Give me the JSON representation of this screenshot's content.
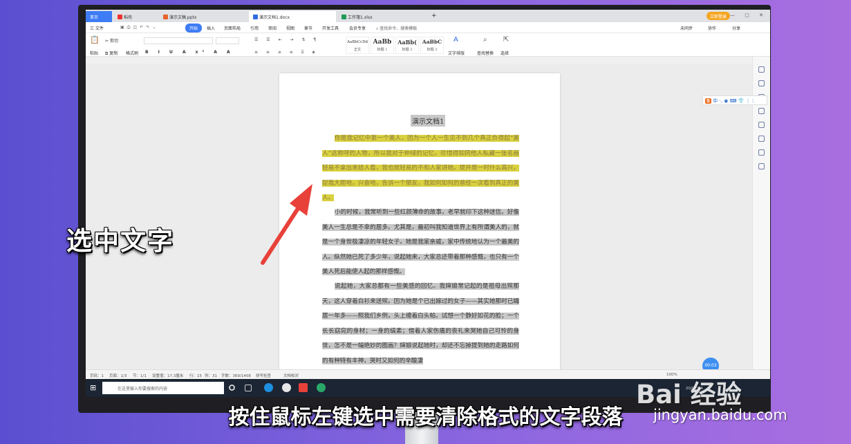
{
  "tabs": [
    {
      "label": "首页"
    },
    {
      "label": "稻壳"
    },
    {
      "label": "演示文稿.pptx"
    },
    {
      "label": "演示文档1.docx"
    },
    {
      "label": "工作簿1.xlsx"
    }
  ],
  "tab_add": "+",
  "login_label": "立即登录",
  "menu": {
    "file": "三 文件",
    "start": "开始",
    "items": [
      "插入",
      "页面布局",
      "引用",
      "审阅",
      "视图",
      "章节",
      "开发工具",
      "会员专享"
    ],
    "search": "查找命令、搜索模板",
    "right": [
      "未同步",
      "协作",
      "分享"
    ]
  },
  "ribbon": {
    "paste": "粘贴",
    "cut": "剪切",
    "copy": "复制",
    "format_painter": "格式刷",
    "styles": [
      {
        "preview": "AaBbCcDd",
        "label": "正文"
      },
      {
        "preview": "AaBb",
        "label": "标题 1"
      },
      {
        "preview": "AaBb(",
        "label": "标题 2"
      },
      {
        "preview": "AaBbC",
        "label": "标题 3"
      }
    ],
    "text_tools": "文字排版",
    "find_replace": "查找替换",
    "select": "选择"
  },
  "doc": {
    "title": "演示文档1",
    "p1": "你是我记忆中第一个美人，因为一个人一生见不到几个真正负得起“美人”这称呼的人物，所以我对于仲绿的记忆，珍惜得如同他人私藏一张名画轻易不拿出来给人看，我也就轻易的不和人家讲她。提并是一时什么高兴，捉我大胆地，兴奋地，告诉一个朋友，我如何如何的曾经一次看到真正的美人。",
    "p2": "小的时候，我常听到一些红颜薄命的故事，老早就印下这种迷信。好像美人一生总是不幸的居多。尤其是，最初叫我知道世界上有所谓美人的，就是一个身世极凄凉的年轻女子。她是我家亲戚，家中传统地认为一个最美的人。纵然她已死了多少年，说起她来，大家总还带着那种感慨，也只有一个美人死后能使人起的那样感慨。",
    "p3": "说起她，大家总都有一些美感的回忆。我婶娘常记起的是祖母出殡那天，这人穿着白衫来送殡。因为她是个已出嫁过的女子——其实她那时已孀居一年多——照我们乡例，头上缠着白头帕。试想一个静好如花的脸；一个长长窈窕的身材；一身的缟素；借着人家伤痛的丧礼来哭她自己可怜的身世，怎不是一幅绝妙的图画？婶娘说起她时，却还不忘掉提到她的走路如何的有种特有丰神，哭时又如何的辛酸凄"
  },
  "ime": {
    "logo": "S",
    "label": "中 ·, ◉ ⌨ 👕 ⋮⋮"
  },
  "status": {
    "page": "页码：1",
    "pages": "页面：1/3",
    "section": "节：1/1",
    "setting": "设置值：17.3厘米",
    "row": "行：15",
    "col": "列：31",
    "words": "字数：369/1408",
    "spell": "拼写检查",
    "proof": "文档校对",
    "zoom": "100%"
  },
  "timer": "00:03",
  "taskbar": {
    "search": "在这里输入你要搜索的内容",
    "time": "2022/1/4"
  },
  "captions": {
    "left": "选中文字",
    "bottom": "按住鼠标左键选中需要清除格式的文字段落"
  },
  "watermark": {
    "brand": "Bai 经验",
    "url": "jingyan.baidu.com"
  },
  "colors": {
    "accent": "#3d7cf4",
    "highlight_yellow": "#d9d13f",
    "selection_gray": "#c8c8c8",
    "arrow_red": "#e8413a",
    "login_orange": "#f5a623"
  },
  "icons": [
    "windows-logo-icon",
    "search-icon",
    "task-view-icon",
    "edge-icon",
    "wps-icon",
    "chrome-icon",
    "arrow-annotation-icon"
  ]
}
